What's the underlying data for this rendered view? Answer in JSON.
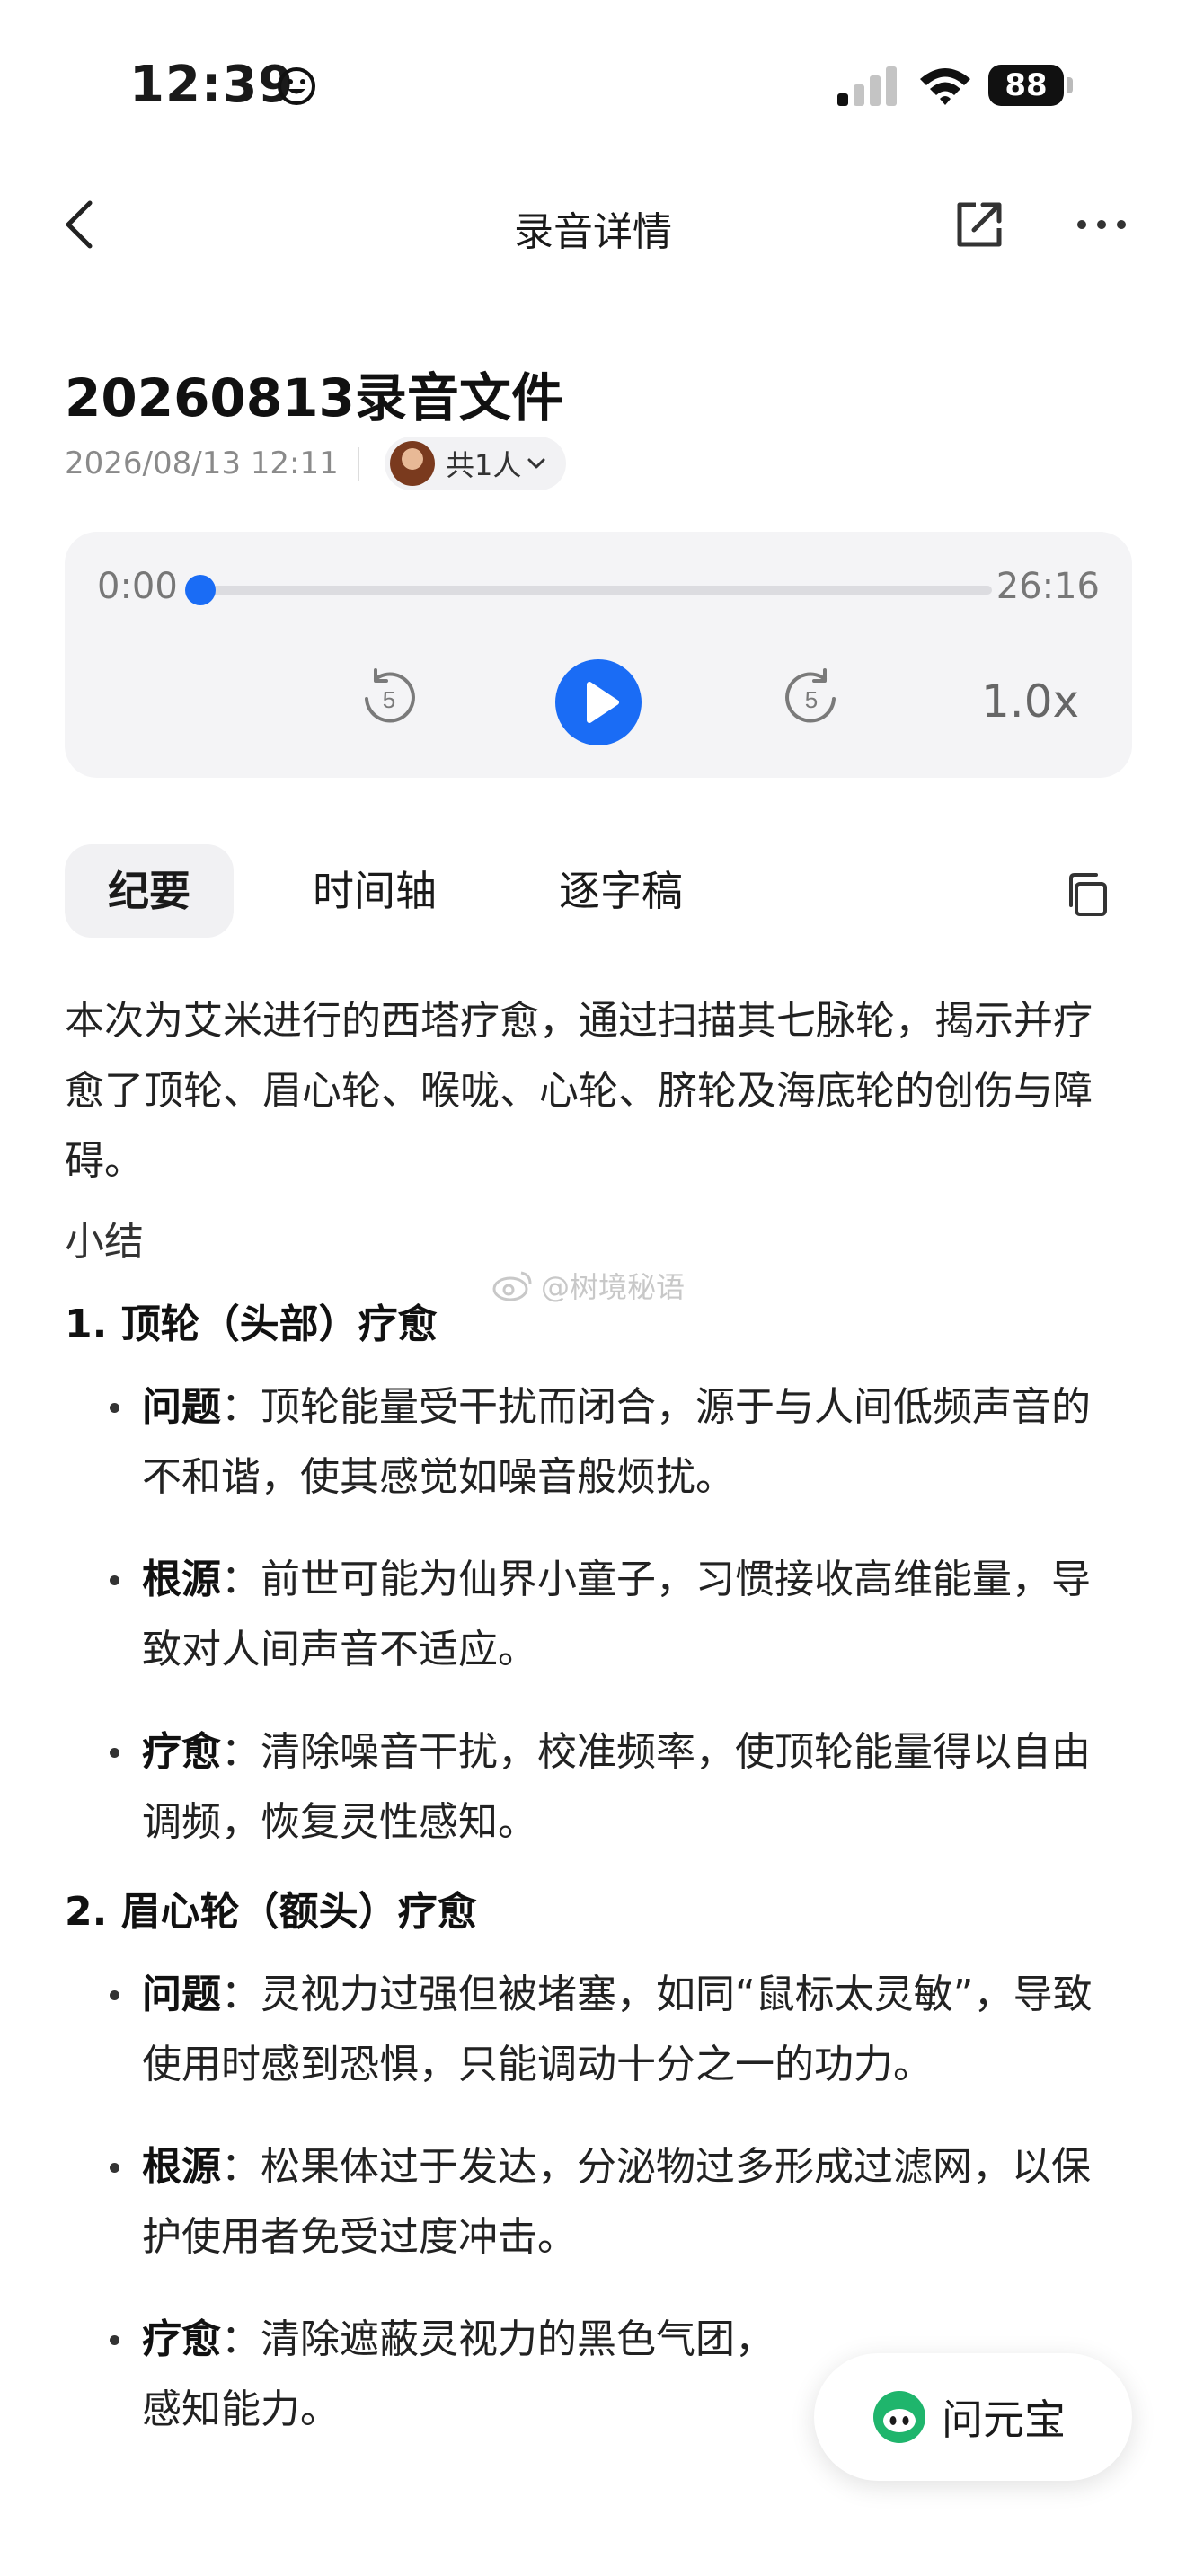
{
  "status_bar": {
    "time": "12:39",
    "battery": "88"
  },
  "nav": {
    "title": "录音详情"
  },
  "recording": {
    "title": "20260813录音文件",
    "datetime": "2026/08/13 12:11",
    "participants": "共1人"
  },
  "player": {
    "current_time": "0:00",
    "total_time": "26:16",
    "progress": 0.0,
    "skip_back_seconds": "5",
    "skip_forward_seconds": "5",
    "speed": "1.0x"
  },
  "tabs": [
    {
      "label": "纪要"
    },
    {
      "label": "时间轴"
    },
    {
      "label": "逐字稿"
    }
  ],
  "content": {
    "intro": "本次为艾米进行的西塔疗愈，通过扫描其七脉轮，揭示并疗愈了顶轮、眉心轮、喉咙、心轮、脐轮及海底轮的创伤与障碍。",
    "summary_heading": "小结",
    "sections": [
      {
        "title": "1. 顶轮（头部）疗愈",
        "items": [
          {
            "label": "问题",
            "text": "：顶轮能量受干扰而闭合，源于与人间低频声音的不和谐，使其感觉如噪音般烦扰。"
          },
          {
            "label": "根源",
            "text": "：前世可能为仙界小童子，习惯接收高维能量，导致对人间声音不适应。"
          },
          {
            "label": "疗愈",
            "text": "：清除噪音干扰，校准频率，使顶轮能量得以自由调频，恢复灵性感知。"
          }
        ]
      },
      {
        "title": "2. 眉心轮（额头）疗愈",
        "items": [
          {
            "label": "问题",
            "text": "：灵视力过强但被堵塞，如同“鼠标太灵敏”，导致使用时感到恐惧，只能调动十分之一的功力。"
          },
          {
            "label": "根源",
            "text": "：松果体过于发达，分泌物过多形成过滤网，以保护使用者免受过度冲击。"
          },
          {
            "label": "疗愈",
            "text": "：清除遮蔽灵视力的黑色气团，"
          },
          {
            "label": "",
            "text": "感知能力。"
          }
        ]
      }
    ]
  },
  "watermark": "@树境秘语",
  "fab": {
    "label": "问元宝"
  },
  "colors": {
    "accent": "#1a6cf5",
    "fab_icon": "#1fb56c"
  }
}
